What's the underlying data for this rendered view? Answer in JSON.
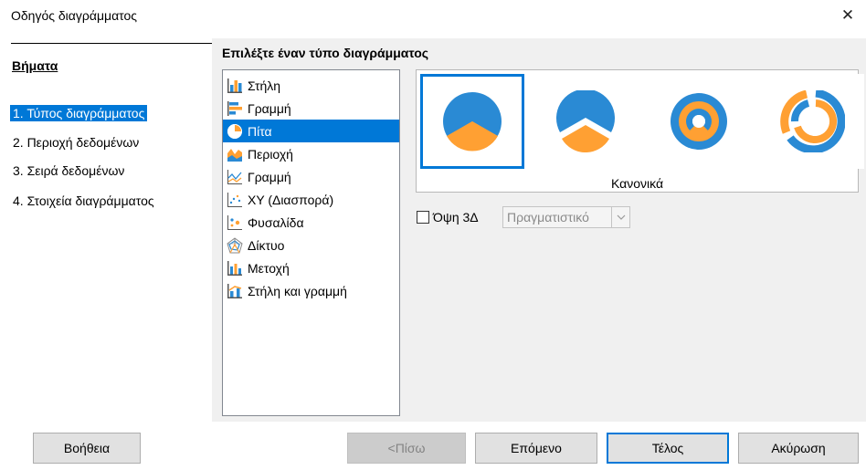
{
  "window": {
    "title": "Οδηγός διαγράμματος",
    "close_icon": "close-icon"
  },
  "steps": {
    "title": "Βήματα",
    "items": [
      {
        "label": "1. Τύπος διαγράμματος",
        "active": true
      },
      {
        "label": "2. Περιοχή δεδομένων",
        "active": false
      },
      {
        "label": "3. Σειρά δεδομένων",
        "active": false
      },
      {
        "label": "4. Στοιχεία διαγράμματος",
        "active": false
      }
    ]
  },
  "chart_type": {
    "heading": "Επιλέξτε έναν τύπο διαγράμματος",
    "types": [
      {
        "label": "Στήλη",
        "icon": "column-chart-icon"
      },
      {
        "label": "Γραμμή",
        "icon": "bar-chart-icon"
      },
      {
        "label": "Πίτα",
        "icon": "pie-chart-icon",
        "selected": true
      },
      {
        "label": "Περιοχή",
        "icon": "area-chart-icon"
      },
      {
        "label": "Γραμμή",
        "icon": "line-chart-icon"
      },
      {
        "label": "XY (Διασπορά)",
        "icon": "xy-scatter-chart-icon"
      },
      {
        "label": "Φυσαλίδα",
        "icon": "bubble-chart-icon"
      },
      {
        "label": "Δίκτυο",
        "icon": "net-chart-icon"
      },
      {
        "label": "Μετοχή",
        "icon": "stock-chart-icon"
      },
      {
        "label": "Στήλη και γραμμή",
        "icon": "column-and-line-chart-icon"
      }
    ],
    "variant_caption": "Κανονικά",
    "variants": [
      "pie-normal-icon",
      "pie-exploded-icon",
      "donut-icon",
      "donut-exploded-icon"
    ],
    "view_3d_label": "Όψη 3Δ",
    "view_3d_checked": false,
    "render_mode": "Πραγματιστικό"
  },
  "colors": {
    "accent": "#0078d7",
    "pie_blue": "#2a8ad4",
    "pie_orange": "#ffa033"
  },
  "buttons": {
    "help": "Βοήθεια",
    "back": "<Πίσω",
    "next": "Επόμενο",
    "finish": "Τέλος",
    "cancel": "Ακύρωση"
  }
}
